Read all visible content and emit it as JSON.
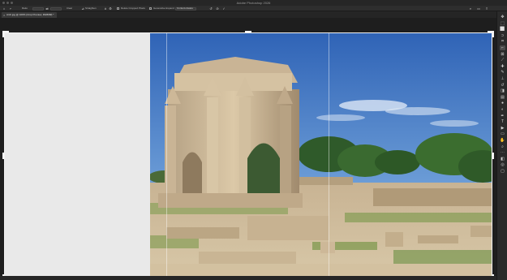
{
  "window": {
    "title": "Adobe Photoshop 2026"
  },
  "options": {
    "ratio_label": "Ratio",
    "clear_label": "Clear",
    "straighten_label": "Straighten",
    "delete_pixels_label": "Delete Cropped Pixels",
    "fill_label": "Generative Expand",
    "content_aware_label": "Content-Aware"
  },
  "document": {
    "tab_label": "Arch.jpg @ 100% (Crop Preview, RGB/8#) *"
  },
  "colors": {
    "accent": "#f2f2f2",
    "sky": "#4a7fc8",
    "transparent_fill": "#e9e9e9"
  },
  "tools": [
    {
      "name": "move-tool",
      "icon": "✥"
    },
    {
      "name": "artboard-tool",
      "icon": "⬚"
    },
    {
      "name": "marquee-tool",
      "icon": "⬜"
    },
    {
      "name": "lasso-tool",
      "icon": "ↄ"
    },
    {
      "name": "object-select-tool",
      "icon": "⌗"
    },
    {
      "name": "crop-tool",
      "icon": "⌐"
    },
    {
      "name": "frame-tool",
      "icon": "⊠"
    },
    {
      "name": "eyedropper-tool",
      "icon": "⟋"
    },
    {
      "name": "healing-tool",
      "icon": "✚"
    },
    {
      "name": "brush-tool",
      "icon": "✎"
    },
    {
      "name": "clone-stamp-tool",
      "icon": "⊥"
    },
    {
      "name": "history-brush-tool",
      "icon": "↺"
    },
    {
      "name": "eraser-tool",
      "icon": "◨"
    },
    {
      "name": "gradient-tool",
      "icon": "▤"
    },
    {
      "name": "blur-tool",
      "icon": "●"
    },
    {
      "name": "dodge-tool",
      "icon": "◐"
    },
    {
      "name": "pen-tool",
      "icon": "✒"
    },
    {
      "name": "type-tool",
      "icon": "T"
    },
    {
      "name": "path-select-tool",
      "icon": "▶"
    },
    {
      "name": "shape-tool",
      "icon": "▭"
    },
    {
      "name": "hand-tool",
      "icon": "✋"
    },
    {
      "name": "zoom-tool",
      "icon": "⌕"
    },
    {
      "name": "more-tools",
      "icon": "⋯"
    },
    {
      "name": "color-swatches",
      "icon": "◧"
    },
    {
      "name": "quick-mask",
      "icon": "◎"
    },
    {
      "name": "screen-mode",
      "icon": "▢"
    }
  ]
}
